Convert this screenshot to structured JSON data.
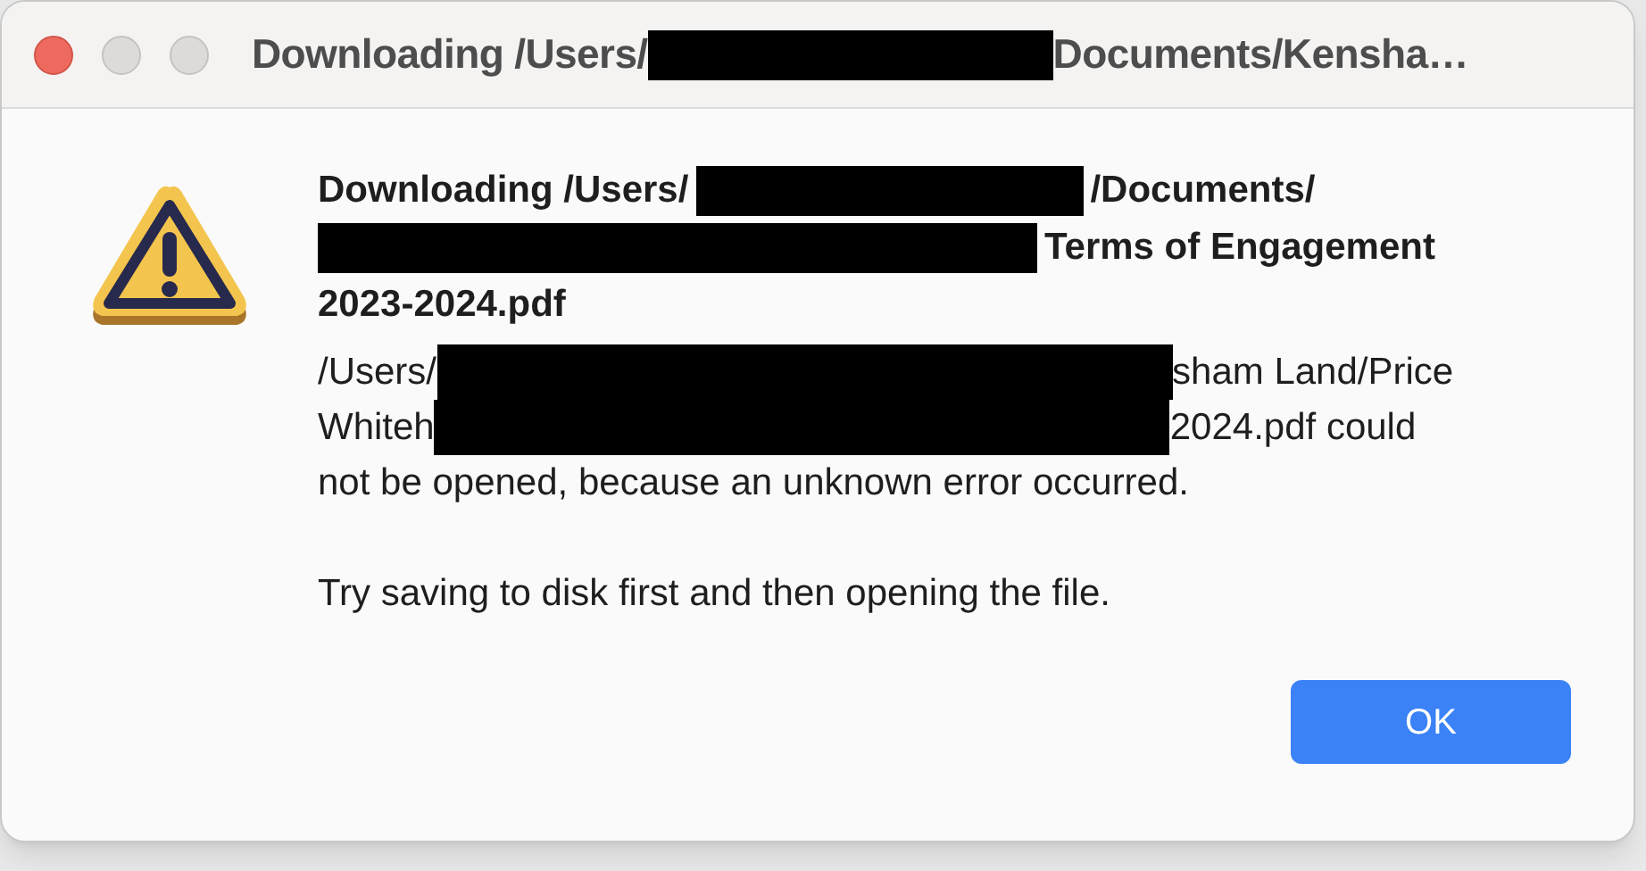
{
  "window": {
    "title": [
      {
        "kind": "text",
        "text": "Downloading /Users/"
      },
      {
        "kind": "redaction"
      },
      {
        "kind": "text",
        "text": "Documents/Kensha…"
      }
    ]
  },
  "heading_lines": [
    [
      {
        "kind": "text",
        "text": "Downloading /Users/"
      },
      {
        "kind": "redaction"
      },
      {
        "kind": "text",
        "text": "/Documents/"
      }
    ],
    [
      {
        "kind": "redaction"
      },
      {
        "kind": "text",
        "text": "Terms of Engagement"
      }
    ],
    [
      {
        "kind": "text",
        "text": "2023-2024.pdf"
      }
    ]
  ],
  "message_lines": [
    [
      {
        "kind": "text",
        "text": "/Users/"
      },
      {
        "kind": "redaction"
      },
      {
        "kind": "text",
        "text": "sham Land/Price"
      }
    ],
    [
      {
        "kind": "text",
        "text": "Whiteh"
      },
      {
        "kind": "redaction"
      },
      {
        "kind": "text",
        "text": "2024.pdf could"
      }
    ],
    [
      {
        "kind": "text",
        "text": "not be opened, because an unknown error occurred."
      }
    ]
  ],
  "hint": "Try saving to disk first and then opening the file.",
  "buttons": [
    {
      "label": "OK",
      "default": true
    }
  ]
}
